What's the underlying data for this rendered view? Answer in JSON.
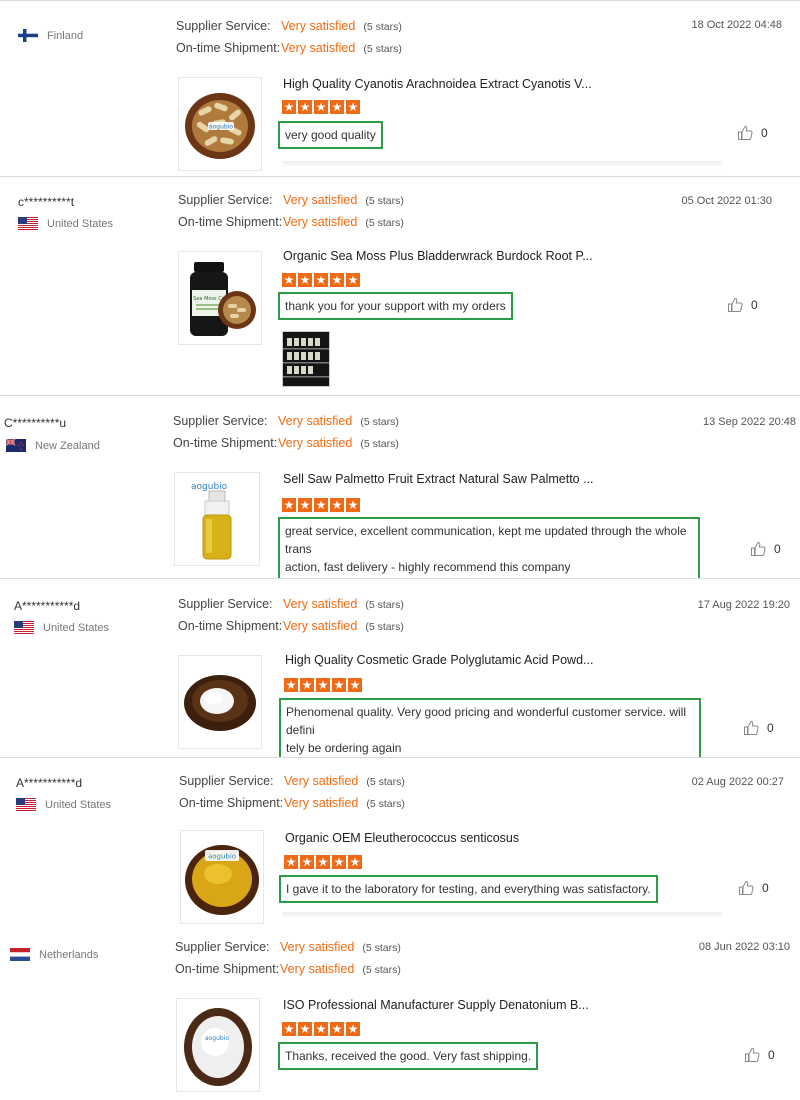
{
  "labels": {
    "supplier_service": "Supplier Service:",
    "ontime_shipment": "On-time Shipment:"
  },
  "colors": {
    "accent_orange": "#f36a10",
    "comment_border": "#2e9b47",
    "star": "#ef6a16"
  },
  "reviews": [
    {
      "buyer": "",
      "country": "Finland",
      "flag": "finland-flag",
      "supplier_service": "Very satisfied",
      "supplier_stars": "(5 stars)",
      "ontime_shipment": "Very satisfied",
      "ontime_stars": "(5 stars)",
      "date": "18 Oct 2022 04:48",
      "product_title": "High Quality Cyanotis Arachnoidea Extract Cyanotis V...",
      "product_image": "capsules-in-bowl-image",
      "rating": 5,
      "comment": "very good quality",
      "likes": "0"
    },
    {
      "buyer": "c**********t",
      "country": "United States",
      "flag": "us-flag",
      "supplier_service": "Very satisfied",
      "supplier_stars": "(5 stars)",
      "ontime_shipment": "Very satisfied",
      "ontime_stars": "(5 stars)",
      "date": "05 Oct 2022 01:30",
      "product_title": "Organic Sea Moss Plus Bladderwrack Burdock Root P...",
      "product_image": "sea-moss-bottle-image",
      "rating": 5,
      "comment": "thank you for your support with my orders",
      "likes": "0",
      "attachment": "shelf-photo-image"
    },
    {
      "buyer": "C**********u",
      "country": "New Zealand",
      "flag": "new-zealand-flag",
      "supplier_service": "Very satisfied",
      "supplier_stars": "(5 stars)",
      "ontime_shipment": "Very satisfied",
      "ontime_stars": "(5 stars)",
      "date": "13 Sep 2022 20:48",
      "product_title": "Sell Saw Palmetto Fruit Extract Natural Saw Palmetto ...",
      "product_image": "oil-bottle-image",
      "rating": 5,
      "comment_line1": "great service, excellent communication, kept me updated through the whole trans",
      "comment_line2": "action, fast delivery - highly recommend this company",
      "likes": "0"
    },
    {
      "buyer": "A***********d",
      "country": "United States",
      "flag": "us-flag",
      "supplier_service": "Very satisfied",
      "supplier_stars": "(5 stars)",
      "ontime_shipment": "Very satisfied",
      "ontime_stars": "(5 stars)",
      "date": "17 Aug 2022 19:20",
      "product_title": "High Quality Cosmetic Grade Polyglutamic Acid Powd...",
      "product_image": "white-powder-bowl-image",
      "rating": 5,
      "comment_line1": "Phenomenal quality. Very good pricing and wonderful customer service. will defini",
      "comment_line2": "tely be ordering again",
      "likes": "0"
    },
    {
      "buyer": "A***********d",
      "country": "United States",
      "flag": "us-flag",
      "supplier_service": "Very satisfied",
      "supplier_stars": "(5 stars)",
      "ontime_shipment": "Very satisfied",
      "ontime_stars": "(5 stars)",
      "date": "02 Aug 2022 00:27",
      "product_title": "Organic OEM Eleutherococcus senticosus",
      "product_image": "yellow-powder-bowl-image",
      "rating": 5,
      "comment": "I gave it to the laboratory for testing, and everything was satisfactory.",
      "likes": "0"
    },
    {
      "buyer": "",
      "country": "Netherlands",
      "flag": "netherlands-flag",
      "supplier_service": "Very satisfied",
      "supplier_stars": "(5 stars)",
      "ontime_shipment": "Very satisfied",
      "ontime_stars": "(5 stars)",
      "date": "08 Jun 2022 03:10",
      "product_title": "ISO Professional Manufacturer Supply Denatonium B...",
      "product_image": "white-powder-bowl-image",
      "rating": 5,
      "comment": "Thanks, received the good. Very fast shipping.",
      "likes": "0"
    }
  ],
  "brand": "aogubio"
}
